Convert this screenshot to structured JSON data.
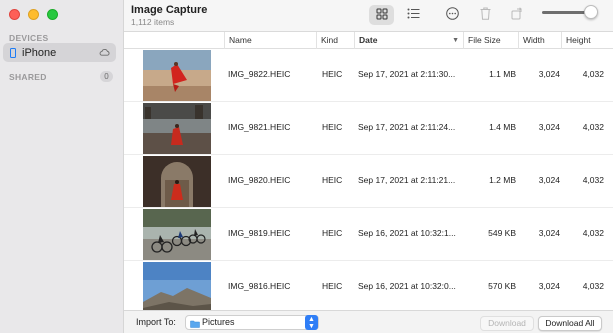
{
  "window": {
    "title": "Image Capture",
    "item_count": "1,112 items"
  },
  "sidebar": {
    "devices_label": "DEVICES",
    "device_name": "iPhone",
    "shared_label": "SHARED",
    "shared_count": "0"
  },
  "table": {
    "columns": [
      "Name",
      "Kind",
      "Date",
      "File Size",
      "Width",
      "Height"
    ],
    "sorted_column": "Date",
    "rows": [
      {
        "name": "IMG_9822.HEIC",
        "kind": "HEIC",
        "date": "Sep 17, 2021 at 2:11:30...",
        "size": "1.1 MB",
        "width": "3,024",
        "height": "4,032",
        "thumbnail": "red-dress-desert-icon"
      },
      {
        "name": "IMG_9821.HEIC",
        "kind": "HEIC",
        "date": "Sep 17, 2021 at 2:11:24...",
        "size": "1.4 MB",
        "width": "3,024",
        "height": "4,032",
        "thumbnail": "red-dress-ruins-icon"
      },
      {
        "name": "IMG_9820.HEIC",
        "kind": "HEIC",
        "date": "Sep 17, 2021 at 2:11:21...",
        "size": "1.2 MB",
        "width": "3,024",
        "height": "4,032",
        "thumbnail": "red-dress-arch-icon"
      },
      {
        "name": "IMG_9819.HEIC",
        "kind": "HEIC",
        "date": "Sep 16, 2021 at 10:32:1...",
        "size": "549 KB",
        "width": "3,024",
        "height": "4,032",
        "thumbnail": "cyclists-icon"
      },
      {
        "name": "IMG_9816.HEIC",
        "kind": "HEIC",
        "date": "Sep 16, 2021 at 10:32:0...",
        "size": "570 KB",
        "width": "3,024",
        "height": "4,032",
        "thumbnail": "mountain-sky-icon"
      }
    ]
  },
  "bottom_bar": {
    "import_label": "Import To:",
    "destination": "Pictures",
    "download_label": "Download",
    "download_all_label": "Download All"
  },
  "colors": {
    "accent": "#2f7ef6",
    "sidebar_bg": "#e9e8ea"
  }
}
